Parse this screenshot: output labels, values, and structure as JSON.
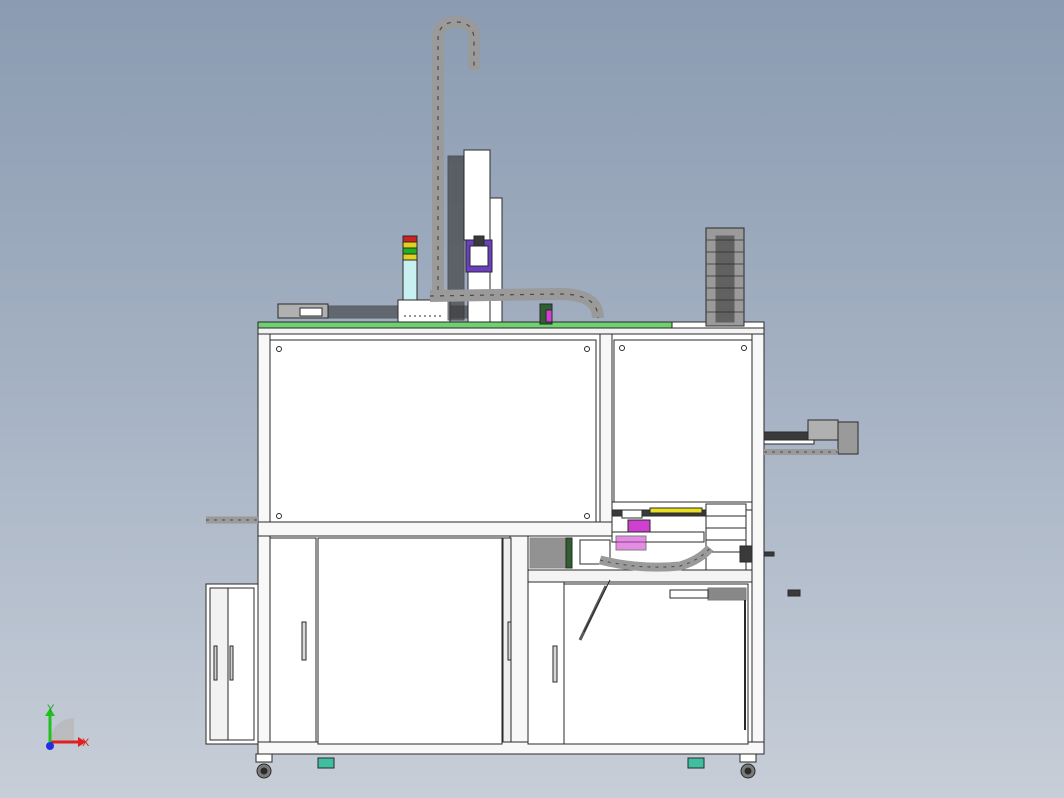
{
  "viewport": {
    "background_top": "#8b9bb1",
    "background_bottom": "#c7ced8"
  },
  "triad": {
    "x_label": "X",
    "y_label": "Y",
    "x_color": "#e02020",
    "y_color": "#20c020",
    "z_color": "#2030e0"
  },
  "colors": {
    "frame": "#ffffff",
    "outline": "#2a2a2a",
    "chain": "#9a9a9a",
    "chain_link": "#4a4a4a",
    "tabletop": "#6fd06f",
    "cyan": "#c8f0f0",
    "purple": "#6a3fc0",
    "magenta": "#d040d0",
    "yellow": "#e8e020",
    "dark_green": "#2f5f2f",
    "beam_dark": "#3a3a3a",
    "teal_foot": "#3fbfa0",
    "light_red": "#e06060",
    "lamp_red": "#d02020",
    "lamp_green": "#20b020",
    "lamp_yellow": "#e0d020"
  }
}
